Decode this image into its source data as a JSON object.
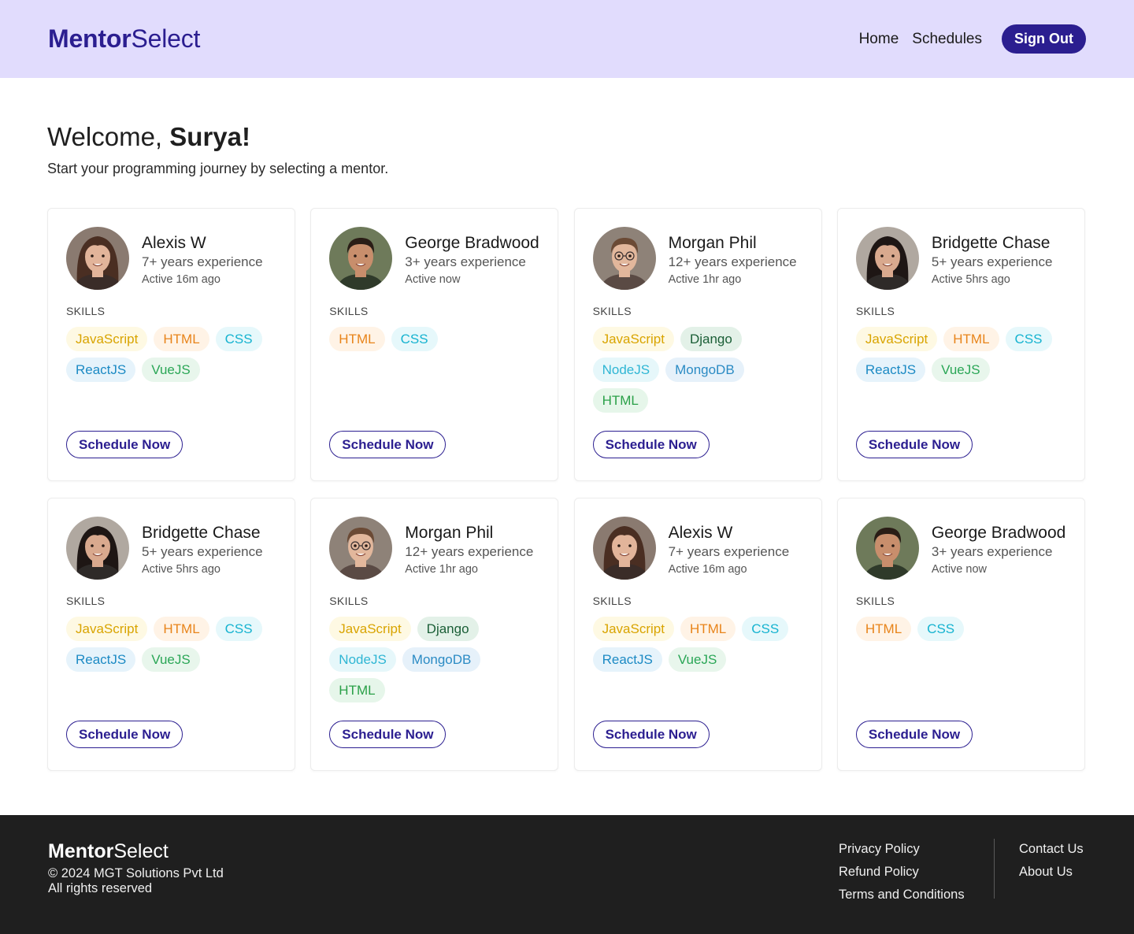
{
  "brand": {
    "name_bold": "Mentor",
    "name_light": "Select",
    "color": "#2b1e90"
  },
  "header": {
    "nav": [
      {
        "label": "Home"
      },
      {
        "label": "Schedules"
      }
    ],
    "signout_label": "Sign Out",
    "background": "#e1dcfd"
  },
  "welcome": {
    "greeting": "Welcome, ",
    "user": "Surya!",
    "subtitle": "Start your programming journey by selecting a mentor."
  },
  "skills_label": "SKILLS",
  "schedule_label": "Schedule Now",
  "skill_colors": {
    "JavaScript": {
      "bg": "#fef9e3",
      "fg": "#d9a400"
    },
    "HTML": {
      "bg": "#fff3e6",
      "fg": "#e8841a"
    },
    "CSS": {
      "bg": "#e6f8fb",
      "fg": "#16b3d0"
    },
    "ReactJS": {
      "bg": "#e6f3fb",
      "fg": "#1c8ac4"
    },
    "VueJS": {
      "bg": "#e8f6ec",
      "fg": "#2aa656"
    },
    "Django": {
      "bg": "#e3f1e8",
      "fg": "#1a5e36"
    },
    "NodeJS": {
      "bg": "#e6f7fa",
      "fg": "#2fb6d4"
    },
    "MongoDB": {
      "bg": "#e6f1fa",
      "fg": "#2b8bc4"
    },
    "HTML_green": {
      "bg": "#e6f6ea",
      "fg": "#2aa048"
    }
  },
  "mentors": [
    {
      "name": "Alexis W",
      "experience": "7+ years experience",
      "active": "Active 16m ago",
      "avatar": "woman-1-icon",
      "skills": [
        "JavaScript",
        "HTML",
        "CSS",
        "ReactJS",
        "VueJS"
      ]
    },
    {
      "name": "George Bradwood",
      "experience": "3+ years experience",
      "active": "Active now",
      "avatar": "man-1-icon",
      "skills": [
        "HTML",
        "CSS"
      ]
    },
    {
      "name": "Morgan Phil",
      "experience": "12+ years experience",
      "active": "Active 1hr ago",
      "avatar": "man-glasses-icon",
      "skills": [
        "JavaScript",
        "Django",
        "NodeJS",
        "MongoDB",
        "HTML_green"
      ]
    },
    {
      "name": "Bridgette Chase",
      "experience": "5+ years experience",
      "active": "Active 5hrs ago",
      "avatar": "woman-2-icon",
      "skills": [
        "JavaScript",
        "HTML",
        "CSS",
        "ReactJS",
        "VueJS"
      ]
    },
    {
      "name": "Bridgette Chase",
      "experience": "5+ years experience",
      "active": "Active 5hrs ago",
      "avatar": "woman-2-icon",
      "skills": [
        "JavaScript",
        "HTML",
        "CSS",
        "ReactJS",
        "VueJS"
      ]
    },
    {
      "name": "Morgan Phil",
      "experience": "12+ years experience",
      "active": "Active 1hr ago",
      "avatar": "man-glasses-icon",
      "skills": [
        "JavaScript",
        "Django",
        "NodeJS",
        "MongoDB",
        "HTML_green"
      ]
    },
    {
      "name": "Alexis W",
      "experience": "7+ years experience",
      "active": "Active 16m ago",
      "avatar": "woman-1-icon",
      "skills": [
        "JavaScript",
        "HTML",
        "CSS",
        "ReactJS",
        "VueJS"
      ]
    },
    {
      "name": "George Bradwood",
      "experience": "3+ years experience",
      "active": "Active now",
      "avatar": "man-1-icon",
      "skills": [
        "HTML",
        "CSS"
      ]
    }
  ],
  "footer": {
    "copyright": "© 2024 MGT Solutions Pvt Ltd",
    "rights": "All rights reserved",
    "links_col1": [
      "Privacy Policy",
      "Refund Policy",
      "Terms and Conditions"
    ],
    "links_col2": [
      "Contact Us",
      "About Us"
    ]
  }
}
